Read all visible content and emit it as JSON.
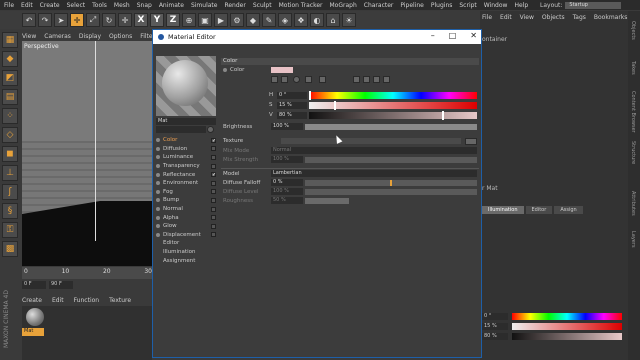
{
  "menubar": [
    "File",
    "Edit",
    "Create",
    "Select",
    "Tools",
    "Mesh",
    "Snap",
    "Animate",
    "Simulate",
    "Render",
    "Sculpt",
    "Motion Tracker",
    "MoGraph",
    "Character",
    "Pipeline",
    "Plugins",
    "Script",
    "Window",
    "Help"
  ],
  "layout": {
    "label": "Layout:",
    "value": "Startup"
  },
  "toolbar": [
    "X",
    "Y",
    "Z"
  ],
  "viewport": {
    "menu": [
      "View",
      "Cameras",
      "Display",
      "Options",
      "Filter"
    ],
    "label": "Perspective"
  },
  "timeline": {
    "ticks": [
      "0",
      "10",
      "20",
      "30"
    ],
    "start": "0 F",
    "end": "90 F"
  },
  "material_manager": {
    "menu": [
      "Create",
      "Edit",
      "Function",
      "Texture"
    ],
    "material": "Mat"
  },
  "brand": "MAXON CINEMA 4D",
  "right_panel": {
    "menu": [
      "File",
      "Edit",
      "View",
      "Objects",
      "Tags",
      "Bookmarks"
    ],
    "obj_row": "ontainer",
    "attr_header": "r Mat",
    "attr_tabs": [
      "Illumination",
      "Editor",
      "Assign"
    ],
    "values": [
      "0 °",
      "15 %",
      "80 %"
    ],
    "side_tabs": [
      "Objects",
      "Takes",
      "Content Browser",
      "Structure",
      "Attributes",
      "Layers"
    ]
  },
  "dialog": {
    "title": "Material Editor",
    "material_name": "Mat",
    "channels": [
      {
        "label": "Color",
        "on": true
      },
      {
        "label": "Diffusion",
        "on": false
      },
      {
        "label": "Luminance",
        "on": false
      },
      {
        "label": "Transparency",
        "on": false
      },
      {
        "label": "Reflectance",
        "on": true
      },
      {
        "label": "Environment",
        "on": false
      },
      {
        "label": "Fog",
        "on": false
      },
      {
        "label": "Bump",
        "on": false
      },
      {
        "label": "Normal",
        "on": false
      },
      {
        "label": "Alpha",
        "on": false
      },
      {
        "label": "Glow",
        "on": false
      },
      {
        "label": "Displacement",
        "on": false
      },
      {
        "label": "Editor",
        "on": null
      },
      {
        "label": "Illumination",
        "on": null
      },
      {
        "label": "Assignment",
        "on": null
      }
    ],
    "color_section": "Color",
    "color_label": "Color",
    "hsv": [
      {
        "label": "H",
        "value": "0 °",
        "pos": 0
      },
      {
        "label": "S",
        "value": "15 %",
        "pos": 0.15
      },
      {
        "label": "V",
        "value": "80 %",
        "pos": 0.8
      }
    ],
    "brightness": {
      "label": "Brightness",
      "value": "100 %"
    },
    "texture_label": "Texture",
    "mix_mode": {
      "label": "Mix Mode",
      "value": "Normal"
    },
    "mix_strength": {
      "label": "Mix Strength",
      "value": "100 %"
    },
    "model": {
      "label": "Model",
      "value": "Lambertian"
    },
    "diffuse_falloff": {
      "label": "Diffuse Falloff",
      "value": "0 %"
    },
    "diffuse_level": {
      "label": "Diffuse Level",
      "value": "100 %"
    },
    "roughness": {
      "label": "Roughness",
      "value": "50 %"
    }
  }
}
